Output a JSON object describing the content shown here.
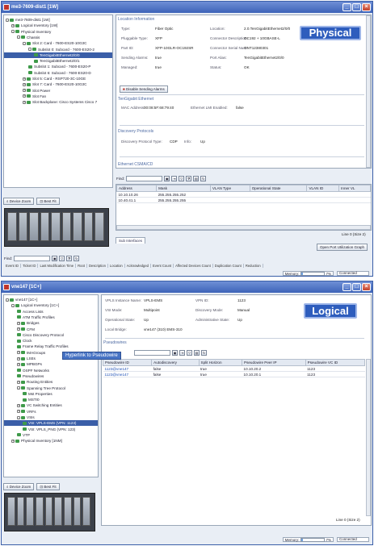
{
  "colors": {
    "title_bar": "#3d63b8",
    "badge": "#2e5dbd",
    "selection": "#3a5ea8",
    "section_header": "#4d6aa3",
    "tooltip": "#4773c4",
    "led": "#3f9a4a"
  },
  "win1": {
    "title": "me3-7609-dist1 [1W]",
    "badge": "Physical",
    "tree": [
      {
        "label": "me3-7609-dist1 [1W]",
        "indent": 0,
        "expander": "-",
        "selected": false
      },
      {
        "label": "Logical Inventory [1W]",
        "indent": 1,
        "expander": "+",
        "selected": false
      },
      {
        "label": "Physical Inventory",
        "indent": 1,
        "expander": "-",
        "selected": false
      },
      {
        "label": "Chassis",
        "indent": 2,
        "expander": "-",
        "selected": false
      },
      {
        "label": "Slot 2: Card - 7600-ES20-10G3C",
        "indent": 3,
        "expander": "-",
        "selected": false
      },
      {
        "label": "Subslot 0: Subcard - 7600-ES20-2",
        "indent": 4,
        "expander": "-",
        "selected": false
      },
      {
        "label": "TenGigabitEthernet2/0/0",
        "indent": 5,
        "expander": "",
        "selected": true
      },
      {
        "label": "TenGigabitEthernet2/0/1",
        "indent": 5,
        "expander": "",
        "selected": false
      },
      {
        "label": "Subslot 1: Subcard - 7600-ES20-P",
        "indent": 4,
        "expander": "",
        "selected": false
      },
      {
        "label": "Subslot 6: Subcard - 7600-ES20-D",
        "indent": 4,
        "expander": "",
        "selected": false
      },
      {
        "label": "Slot 5: Card - RSP720-3C-10GE",
        "indent": 3,
        "expander": "+",
        "selected": false
      },
      {
        "label": "Slot 7: Card - 7600-ES20-10G3C",
        "indent": 3,
        "expander": "+",
        "selected": false
      },
      {
        "label": "Slot Power",
        "indent": 3,
        "expander": "+",
        "selected": false
      },
      {
        "label": "Slot Fan",
        "indent": 3,
        "expander": "+",
        "selected": false
      },
      {
        "label": "Slot Backplane: Cisco Systems Cisco 7",
        "indent": 3,
        "expander": "+",
        "selected": false
      }
    ],
    "device_zoom": "Device Zoom",
    "best_fit": "Best Fit",
    "location_header": "Location Information",
    "fields_left": [
      {
        "label": "Type:",
        "value": "Fiber Optic"
      },
      {
        "label": "Pluggable Type:",
        "value": "XFP"
      },
      {
        "label": "Part ID:",
        "value": "XFP-10GLR-OC192SR"
      },
      {
        "label": "Sending Alarms:",
        "value": "true"
      },
      {
        "label": "Managed:",
        "value": "true"
      }
    ],
    "fields_right": [
      {
        "label": "Location:",
        "value": "2.0.TenGigabitEthernet2/0/0"
      },
      {
        "label": "Connector Description:",
        "value": "OC192 + 10GBASE-L"
      },
      {
        "label": "Connector Serial Num:",
        "value": "ONT12380301"
      },
      {
        "label": "Port Alias:",
        "value": "TenGigabitEthernet2/0/0"
      },
      {
        "label": "Status:",
        "value": "OK"
      }
    ],
    "disable_alarms": "Disable Sending Alarms",
    "tengig_header": "TenGigabit Ethernet",
    "mac_label": "MAC Address:",
    "mac_value": "00:08:5F:68:79:40",
    "lmi_label": "Ethernet LMI Enabled:",
    "lmi_value": "false",
    "discovery_header": "Discovery Protocols",
    "disc_type_label": "Discovery Protocol Type:",
    "disc_type_value": "CDP",
    "info_label": "Info:",
    "info_value": "Up",
    "ethernet_header": "Ethernet CSMA/CD",
    "find_label": "Find:",
    "table_headers": [
      "Address",
      "Mask",
      "VLAN Type",
      "Operational State",
      "VLAN ID",
      "Inner VL"
    ],
    "rows": [
      [
        "10.10.10.26",
        "255.255.255.252",
        "",
        "",
        "",
        ""
      ],
      [
        "10.40.41.1",
        "255.255.255.255",
        "",
        "",
        "",
        ""
      ]
    ],
    "line_info": "Line 0 (Size 2)",
    "tab": "Sub Interfaces",
    "open_port": "Open Port Utilization Graph",
    "events_find": "Find:",
    "event_headers": [
      "Event ID",
      "Ticket ID",
      "Last Modification Time",
      "Root",
      "Description",
      "Location",
      "Acknowledged",
      "Event Count",
      "Affected Devices Count",
      "Duplication Count",
      "Reduction"
    ],
    "memory_label": "Memory:",
    "memory_value": "7%",
    "memory_fraction": 0.07,
    "connected": "Connected"
  },
  "win2": {
    "title": "vne147 [1C+]",
    "badge": "Logical",
    "tree": [
      {
        "label": "vne147 [1C+]",
        "indent": 0,
        "expander": "-",
        "selected": false
      },
      {
        "label": "Logical Inventory [1C+]",
        "indent": 1,
        "expander": "-",
        "selected": false
      },
      {
        "label": "Access Lists",
        "indent": 2,
        "expander": "",
        "selected": false
      },
      {
        "label": "ATM Traffic Profiles",
        "indent": 2,
        "expander": "",
        "selected": false
      },
      {
        "label": "Bridges",
        "indent": 2,
        "expander": "+",
        "selected": false
      },
      {
        "label": "CFM",
        "indent": 2,
        "expander": "+",
        "selected": false
      },
      {
        "label": "Cisco Discovery Protocol",
        "indent": 2,
        "expander": "",
        "selected": false
      },
      {
        "label": "Clock",
        "indent": 2,
        "expander": "",
        "selected": false
      },
      {
        "label": "Frame Relay Traffic Profiles",
        "indent": 2,
        "expander": "",
        "selected": false
      },
      {
        "label": "IMAGroups",
        "indent": 2,
        "expander": "+",
        "selected": false
      },
      {
        "label": "LSEs",
        "indent": 2,
        "expander": "+",
        "selected": false
      },
      {
        "label": "MPBGPs",
        "indent": 2,
        "expander": "+",
        "selected": false
      },
      {
        "label": "OSPF Networks",
        "indent": 2,
        "expander": "",
        "selected": false
      },
      {
        "label": "Pseudowires",
        "indent": 2,
        "expander": "",
        "selected": false
      },
      {
        "label": "Routing Entities",
        "indent": 2,
        "expander": "+",
        "selected": false
      },
      {
        "label": "Spanning Tree Protocol",
        "indent": 2,
        "expander": "-",
        "selected": false
      },
      {
        "label": "Mst Properties",
        "indent": 3,
        "expander": "",
        "selected": false
      },
      {
        "label": "MSTI0",
        "indent": 3,
        "expander": "",
        "selected": false
      },
      {
        "label": "VC Switching Entities",
        "indent": 2,
        "expander": "+",
        "selected": false
      },
      {
        "label": "VRFs",
        "indent": 2,
        "expander": "+",
        "selected": false
      },
      {
        "label": "VSIs",
        "indent": 2,
        "expander": "-",
        "selected": false
      },
      {
        "label": "VSI: VPLS-EMS (VPN: 1123)",
        "indent": 3,
        "expander": "",
        "selected": true
      },
      {
        "label": "VSI: VPLS_PNG (VPN: 123)",
        "indent": 3,
        "expander": "",
        "selected": false
      },
      {
        "label": "VTP",
        "indent": 2,
        "expander": "",
        "selected": false
      },
      {
        "label": "Physical Inventory [1NM]",
        "indent": 1,
        "expander": "+",
        "selected": false
      }
    ],
    "device_zoom": "Device Zoom",
    "best_fit": "Best Fit",
    "fields_left": [
      {
        "label": "VPLS Instance Name:",
        "value": "VPLS-EMS"
      },
      {
        "label": "VSI Mode:",
        "value": "Multipoint"
      },
      {
        "label": "Operational State:",
        "value": "Up"
      },
      {
        "label": "Local Bridge:",
        "value": "vne147 (310) EMS-310"
      }
    ],
    "fields_right": [
      {
        "label": "VPN ID:",
        "value": "1123"
      },
      {
        "label": "Discovery Mode:",
        "value": "Manual"
      },
      {
        "label": "Administrative State:",
        "value": "Up"
      }
    ],
    "pseudowires_header": "Pseudowires",
    "tooltip": "Hyperlink to Pseudowire",
    "table_headers": [
      "Pseudowire ID",
      "Autodiscovery",
      "Split Horizon",
      "Pseudowire Peer IP",
      "Pseudowire VC ID"
    ],
    "rows": [
      [
        "1123@vne147",
        "false",
        "true",
        "10.10.20.2",
        "1123"
      ],
      [
        "1123@vne147",
        "false",
        "true",
        "10.10.20.1",
        "1123"
      ]
    ],
    "line_info": "Line 0 (Size 2)",
    "memory_label": "Memory:",
    "memory_value": "7%",
    "memory_fraction": 0.07,
    "connected": "Connected"
  }
}
